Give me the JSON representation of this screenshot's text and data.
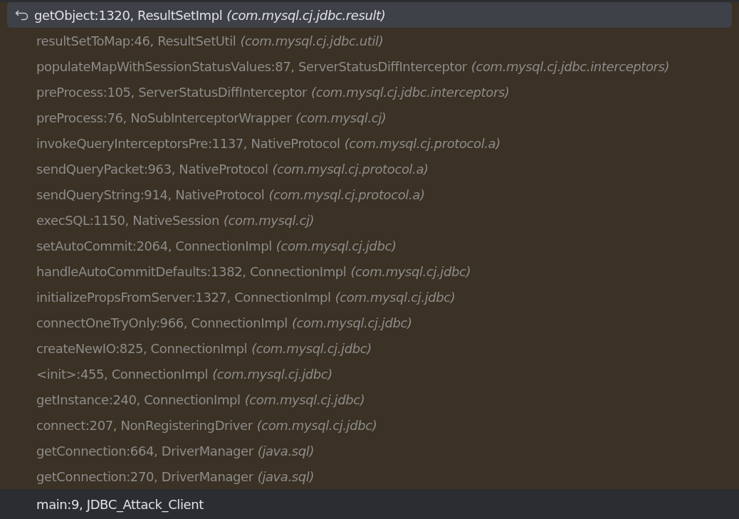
{
  "frames": [
    {
      "label": "getObject:1320, ResultSetImpl",
      "package": "(com.mysql.cj.jdbc.result)",
      "kind": "library",
      "selected": true
    },
    {
      "label": "resultSetToMap:46, ResultSetUtil",
      "package": "(com.mysql.cj.jdbc.util)",
      "kind": "library",
      "selected": false
    },
    {
      "label": "populateMapWithSessionStatusValues:87, ServerStatusDiffInterceptor",
      "package": "(com.mysql.cj.jdbc.interceptors)",
      "kind": "library",
      "selected": false
    },
    {
      "label": "preProcess:105, ServerStatusDiffInterceptor",
      "package": "(com.mysql.cj.jdbc.interceptors)",
      "kind": "library",
      "selected": false
    },
    {
      "label": "preProcess:76, NoSubInterceptorWrapper",
      "package": "(com.mysql.cj)",
      "kind": "library",
      "selected": false
    },
    {
      "label": "invokeQueryInterceptorsPre:1137, NativeProtocol",
      "package": "(com.mysql.cj.protocol.a)",
      "kind": "library",
      "selected": false
    },
    {
      "label": "sendQueryPacket:963, NativeProtocol",
      "package": "(com.mysql.cj.protocol.a)",
      "kind": "library",
      "selected": false
    },
    {
      "label": "sendQueryString:914, NativeProtocol",
      "package": "(com.mysql.cj.protocol.a)",
      "kind": "library",
      "selected": false
    },
    {
      "label": "execSQL:1150, NativeSession",
      "package": "(com.mysql.cj)",
      "kind": "library",
      "selected": false
    },
    {
      "label": "setAutoCommit:2064, ConnectionImpl",
      "package": "(com.mysql.cj.jdbc)",
      "kind": "library",
      "selected": false
    },
    {
      "label": "handleAutoCommitDefaults:1382, ConnectionImpl",
      "package": "(com.mysql.cj.jdbc)",
      "kind": "library",
      "selected": false
    },
    {
      "label": "initializePropsFromServer:1327, ConnectionImpl",
      "package": "(com.mysql.cj.jdbc)",
      "kind": "library",
      "selected": false
    },
    {
      "label": "connectOneTryOnly:966, ConnectionImpl",
      "package": "(com.mysql.cj.jdbc)",
      "kind": "library",
      "selected": false
    },
    {
      "label": "createNewIO:825, ConnectionImpl",
      "package": "(com.mysql.cj.jdbc)",
      "kind": "library",
      "selected": false
    },
    {
      "label": "<init>:455, ConnectionImpl",
      "package": "(com.mysql.cj.jdbc)",
      "kind": "library",
      "selected": false
    },
    {
      "label": "getInstance:240, ConnectionImpl",
      "package": "(com.mysql.cj.jdbc)",
      "kind": "library",
      "selected": false
    },
    {
      "label": "connect:207, NonRegisteringDriver",
      "package": "(com.mysql.cj.jdbc)",
      "kind": "library",
      "selected": false
    },
    {
      "label": "getConnection:664, DriverManager",
      "package": "(java.sql)",
      "kind": "library",
      "selected": false
    },
    {
      "label": "getConnection:270, DriverManager",
      "package": "(java.sql)",
      "kind": "library",
      "selected": false
    },
    {
      "label": "main:9, JDBC_Attack_Client",
      "kind": "user",
      "selected": false
    }
  ]
}
